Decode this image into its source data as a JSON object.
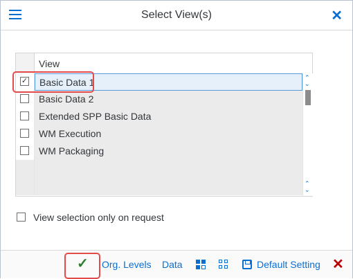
{
  "dialog": {
    "title": "Select View(s)",
    "close_glyph": "✕"
  },
  "table": {
    "column_header": "View",
    "rows": [
      {
        "label": "Basic Data 1",
        "checked": true
      },
      {
        "label": "Basic Data 2",
        "checked": false
      },
      {
        "label": "Extended SPP Basic Data",
        "checked": false
      },
      {
        "label": "WM Execution",
        "checked": false
      },
      {
        "label": "WM Packaging",
        "checked": false
      }
    ],
    "check_glyph": "✓"
  },
  "option": {
    "label": "View selection only on request",
    "checked": false
  },
  "footer": {
    "ok_glyph": "✓",
    "org_levels": "Org. Levels",
    "data": "Data",
    "default_setting": "Default Setting",
    "cancel_glyph": "✕"
  },
  "colors": {
    "accent": "#0a6ed1",
    "highlight": "#e34b4b",
    "ok": "#2b7d2b",
    "cancel": "#bb0000"
  }
}
